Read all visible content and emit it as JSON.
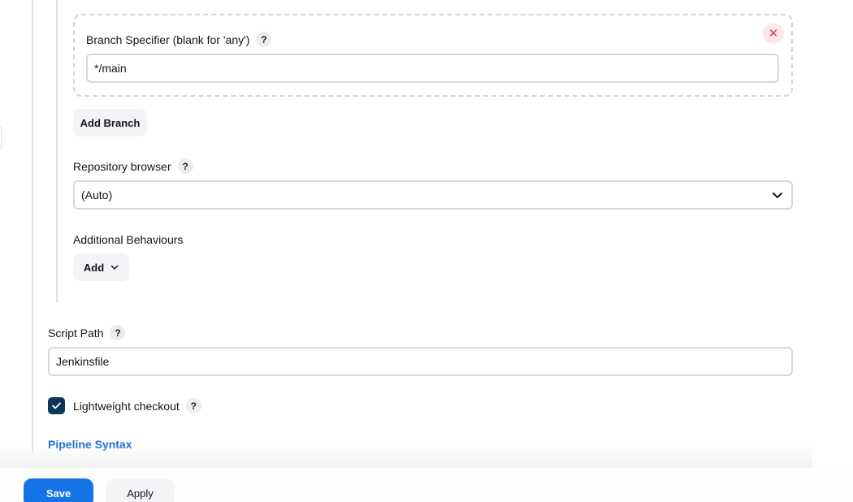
{
  "scm": {
    "branch_specifier": {
      "label": "Branch Specifier (blank for 'any')",
      "value": "*/main",
      "remove_icon": "close-icon"
    },
    "add_branch_label": "Add Branch",
    "repository_browser": {
      "label": "Repository browser",
      "selected": "(Auto)"
    },
    "additional_behaviours": {
      "label": "Additional Behaviours",
      "add_label": "Add"
    }
  },
  "script_path": {
    "label": "Script Path",
    "value": "Jenkinsfile"
  },
  "lightweight_checkout": {
    "label": "Lightweight checkout",
    "checked": true
  },
  "help_glyph": "?",
  "pipeline_syntax_link": "Pipeline Syntax",
  "footer": {
    "save_label": "Save",
    "apply_label": "Apply"
  },
  "colors": {
    "primary": "#1473e6",
    "checkbox": "#0d3557",
    "danger": "#e5364b",
    "link": "#1a6ed8"
  }
}
